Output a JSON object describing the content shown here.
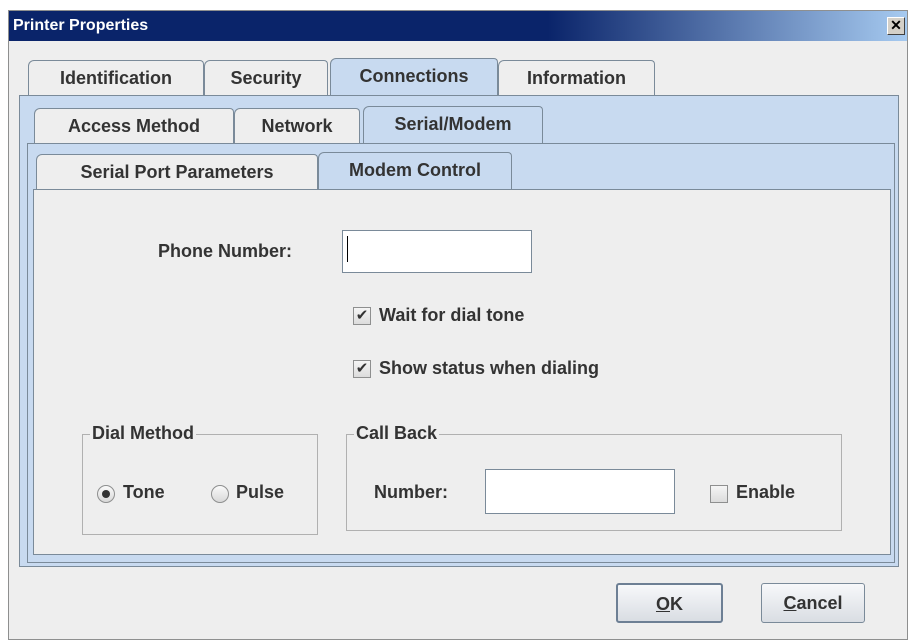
{
  "window": {
    "title": "Printer Properties",
    "close_glyph": "✕"
  },
  "tabs_level1": [
    "Identification",
    "Security",
    "Connections",
    "Information"
  ],
  "tabs_level2": [
    "Access Method",
    "Network",
    "Serial/Modem"
  ],
  "tabs_level3": [
    "Serial Port Parameters",
    "Modem Control"
  ],
  "form": {
    "phone_label": "Phone Number:",
    "phone_value": "",
    "wait_dial_tone": {
      "label": "Wait for dial tone",
      "checked": true
    },
    "show_status": {
      "label": "Show status when dialing",
      "checked": true
    },
    "check_glyph": "✔"
  },
  "dial_method": {
    "legend": "Dial Method",
    "options": [
      {
        "label": "Tone",
        "selected": true
      },
      {
        "label": "Pulse",
        "selected": false
      }
    ]
  },
  "call_back": {
    "legend": "Call Back",
    "number_label": "Number:",
    "number_value": "",
    "enable_label": "Enable",
    "enable_checked": false
  },
  "buttons": {
    "ok_mnemonic": "O",
    "ok_rest": "K",
    "cancel_mnemonic": "C",
    "cancel_rest": "ancel"
  }
}
